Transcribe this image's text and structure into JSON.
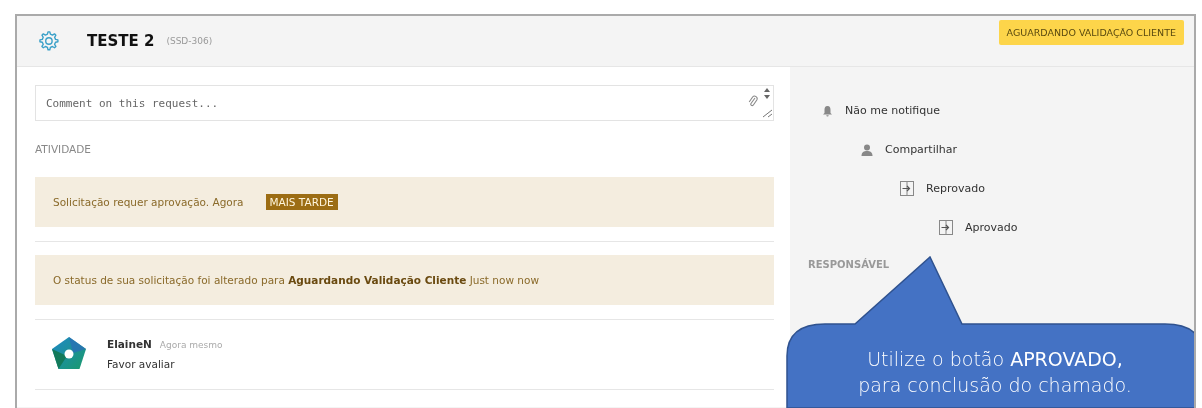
{
  "header": {
    "title": "TESTE 2",
    "key": "(SSD-306)",
    "status": "AGUARDANDO VALIDAÇÃO CLIENTE"
  },
  "comment": {
    "placeholder": "Comment on this request..."
  },
  "activity": {
    "heading": "ATIVIDADE",
    "items": [
      {
        "kind": "approval",
        "text": "Solicitação requer aprovação. Agora",
        "action": "MAIS TARDE"
      },
      {
        "kind": "status",
        "text": "O status de sua solicitação foi alterado para **Aguardando Validação Cliente** Just now now"
      },
      {
        "kind": "comment",
        "author": "ElaineN",
        "time": "Agora mesmo",
        "text": "Favor avaliar"
      }
    ]
  },
  "sidebar": {
    "actions": [
      {
        "kind": "bell",
        "label": "Não me notifique",
        "children": [
          {
            "kind": "person",
            "label": "Compartilhar",
            "children": [
              {
                "kind": "transition",
                "label": "Reprovado",
                "children": [
                  {
                    "kind": "transition",
                    "label": "Aprovado"
                  }
                ]
              }
            ]
          }
        ]
      }
    ],
    "responsible_heading": "RESPONSÁVEL"
  },
  "callout": {
    "text": "Utilize o botão **APROVADO,**\npara conclusão do chamado."
  }
}
